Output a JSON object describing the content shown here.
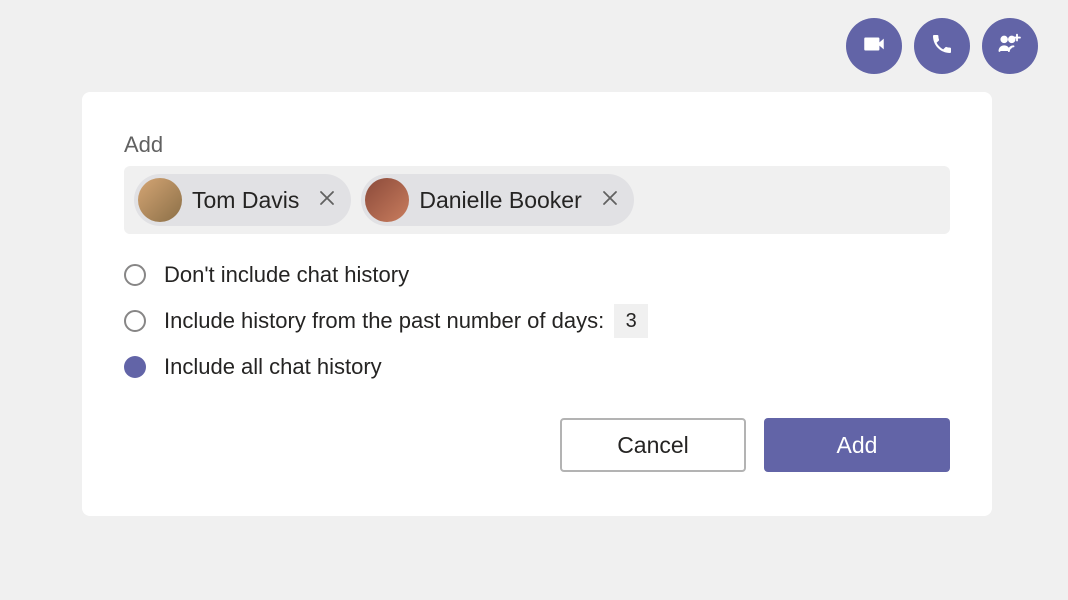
{
  "actionBar": {
    "video": "video-icon",
    "call": "phone-icon",
    "addPeople": "add-people-icon"
  },
  "dialog": {
    "title": "Add",
    "people": [
      {
        "name": "Tom Davis"
      },
      {
        "name": "Danielle Booker"
      }
    ],
    "options": {
      "none": "Don't include chat history",
      "days_prefix": "Include history from the past number of days:",
      "days_value": "3",
      "all": "Include all chat history",
      "selected": "all"
    },
    "buttons": {
      "cancel": "Cancel",
      "add": "Add"
    }
  }
}
